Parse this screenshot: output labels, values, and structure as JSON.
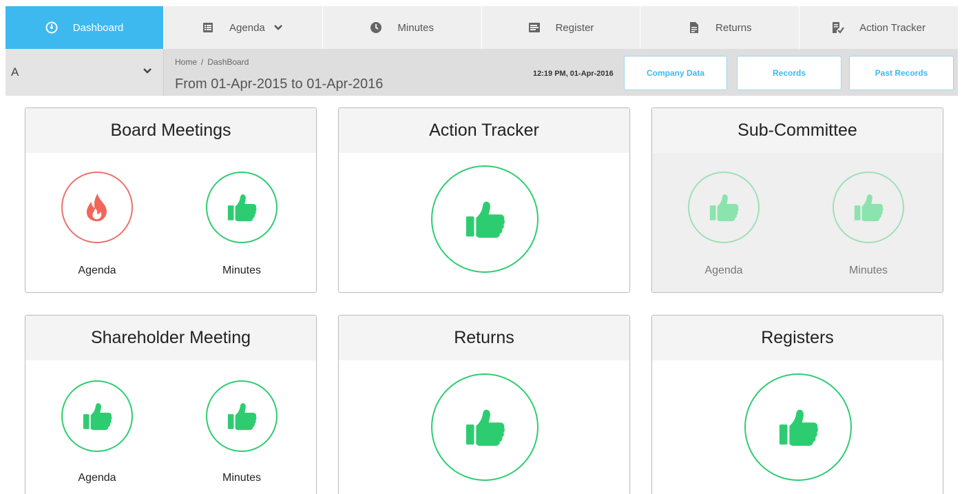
{
  "nav": {
    "items": [
      {
        "label": "Dashboard",
        "icon": "dashboard-icon"
      },
      {
        "label": "Agenda",
        "icon": "list-icon"
      },
      {
        "label": "Minutes",
        "icon": "clock-icon"
      },
      {
        "label": "Register",
        "icon": "register-icon"
      },
      {
        "label": "Returns",
        "icon": "document-icon"
      },
      {
        "label": "Action Tracker",
        "icon": "checklist-icon"
      }
    ]
  },
  "subbar": {
    "company_selected": "A",
    "breadcrumb": [
      "Home",
      "DashBoard"
    ],
    "breadcrumb_sep": "/",
    "period": "From 01-Apr-2015 to 01-Apr-2016",
    "clock": "12:19 PM, 01-Apr-2016",
    "buttons": [
      "Company Data",
      "Records",
      "Past Records"
    ]
  },
  "cards": [
    {
      "title": "Board Meetings",
      "items": [
        {
          "label": "Agenda",
          "icon": "fire-icon",
          "status": "alert"
        },
        {
          "label": "Minutes",
          "icon": "thumbs-up-icon",
          "status": "ok"
        }
      ]
    },
    {
      "title": "Action Tracker",
      "items": [
        {
          "icon": "thumbs-up-icon",
          "status": "ok"
        }
      ]
    },
    {
      "title": "Sub-Committee",
      "items": [
        {
          "label": "Agenda",
          "icon": "thumbs-up-icon",
          "status": "inactive"
        },
        {
          "label": "Minutes",
          "icon": "thumbs-up-icon",
          "status": "inactive"
        }
      ]
    },
    {
      "title": "Shareholder Meeting",
      "items": [
        {
          "label": "Agenda",
          "icon": "thumbs-up-icon",
          "status": "ok"
        },
        {
          "label": "Minutes",
          "icon": "thumbs-up-icon",
          "status": "ok"
        }
      ]
    },
    {
      "title": "Returns",
      "items": [
        {
          "icon": "thumbs-up-icon",
          "status": "ok"
        }
      ]
    },
    {
      "title": "Registers",
      "items": [
        {
          "icon": "thumbs-up-icon",
          "status": "ok"
        }
      ]
    }
  ],
  "colors": {
    "accent": "#3db9f0",
    "ok_green": "#2ecc71",
    "alert_red": "#e8736a",
    "inactive_green": "#9ee0b6"
  }
}
